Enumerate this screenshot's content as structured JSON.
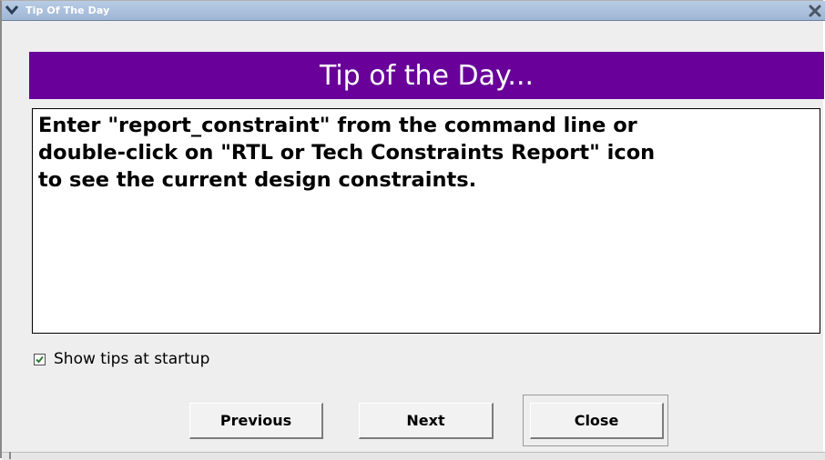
{
  "window": {
    "title": "Tip Of The Day",
    "menu_icon": "chevron-down-icon",
    "close_icon": "close-icon"
  },
  "header": {
    "text": "Tip of the Day...",
    "background_color": "#680099"
  },
  "tip": {
    "lines": [
      "Enter \"report_constraint\" from the command line or",
      "double-click on \"RTL or Tech Constraints Report\" icon",
      "to see the current design constraints."
    ]
  },
  "startup": {
    "checked": true,
    "label": "Show tips at startup"
  },
  "buttons": {
    "previous": "Previous",
    "next": "Next",
    "close": "Close"
  }
}
